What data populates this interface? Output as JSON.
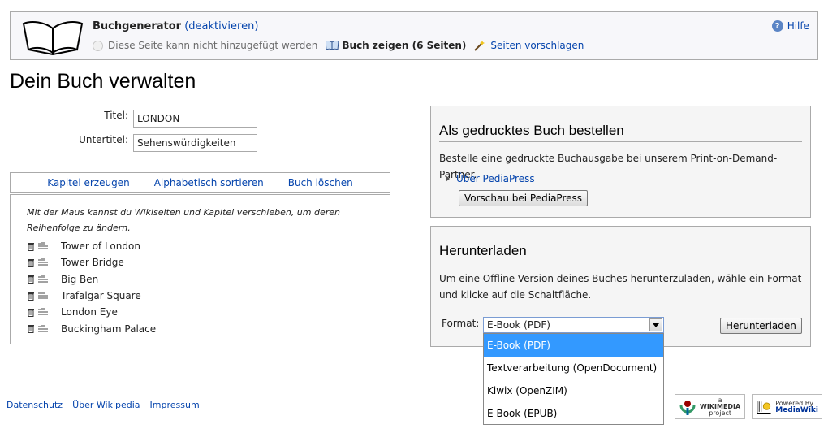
{
  "banner": {
    "title": "Buchgenerator",
    "deactivate_link": "(deaktivieren)",
    "cannot_add_text": "Diese Seite kann nicht hinzugefügt werden",
    "show_book_label": "Buch zeigen (6 Seiten)",
    "suggest_label": "Seiten vorschlagen",
    "help_label": "Hilfe"
  },
  "page": {
    "title": "Dein Buch verwalten"
  },
  "form": {
    "title_label": "Titel:",
    "title_value": "LONDON",
    "subtitle_label": "Untertitel:",
    "subtitle_value": "Sehenswürdigkeiten"
  },
  "toolbar": {
    "create_chapter": "Kapitel erzeugen",
    "sort_alpha": "Alphabetisch sortieren",
    "delete_book": "Buch löschen"
  },
  "list": {
    "hint": "Mit der Maus kannst du Wikiseiten und Kapitel verschieben, um deren Reihenfolge zu ändern.",
    "items": [
      "Tower of London",
      "Tower Bridge",
      "Big Ben",
      "Trafalgar Square",
      "London Eye",
      "Buckingham Palace"
    ]
  },
  "print_box": {
    "heading": "Als gedrucktes Buch bestellen",
    "text": "Bestelle eine gedruckte Buchausgabe bei unserem Print-on-Demand-Partner.",
    "about_link": "Über PediaPress",
    "preview_button": "Vorschau bei PediaPress"
  },
  "download_box": {
    "heading": "Herunterladen",
    "text_line1": "Um eine Offline-Version deines Buches herunterzuladen, wähle ein Format",
    "text_line2": "und klicke auf die Schaltfläche.",
    "format_label": "Format:",
    "selected_format": "E-Book (PDF)",
    "options": [
      "E-Book (PDF)",
      "Textverarbeitung (OpenDocument)",
      "Kiwix (OpenZIM)",
      "E-Book (EPUB)"
    ],
    "download_button": "Herunterladen"
  },
  "footer": {
    "links": [
      "Datenschutz",
      "Über Wikipedia",
      "Impressum"
    ],
    "wikimedia_badge": [
      "a",
      "WIKIMEDIA",
      "project"
    ],
    "mediawiki_badge": [
      "Powered By",
      "MediaWiki"
    ]
  },
  "colors": {
    "link": "#0645ad",
    "selection": "#3399ff",
    "box_bg": "#f5f5f5"
  }
}
